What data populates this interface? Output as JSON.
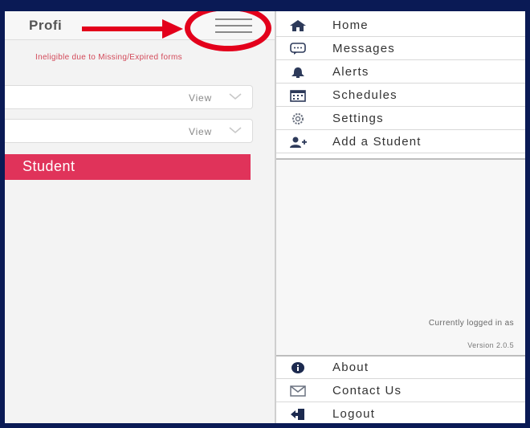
{
  "left_panel": {
    "title": "Profi",
    "notice": "Ineligible due to Missing/Expired forms",
    "rows": [
      {
        "action": "View"
      },
      {
        "action": "View"
      }
    ],
    "add_student_label": "Student"
  },
  "drawer": {
    "menu": [
      {
        "label": "Home",
        "icon": "home-icon"
      },
      {
        "label": "Messages",
        "icon": "message-icon"
      },
      {
        "label": "Alerts",
        "icon": "bell-icon"
      },
      {
        "label": "Schedules",
        "icon": "calendar-icon"
      },
      {
        "label": "Settings",
        "icon": "gear-icon"
      },
      {
        "label": "Add a Student",
        "icon": "add-user-icon"
      }
    ],
    "logged_in_text": "Currently logged in as",
    "version_text": "Version 2.0.5",
    "footer_menu": [
      {
        "label": "About",
        "icon": "info-icon"
      },
      {
        "label": "Contact Us",
        "icon": "envelope-icon"
      },
      {
        "label": "Logout",
        "icon": "logout-icon"
      }
    ]
  },
  "colors": {
    "frame": "#0a1a55",
    "accent_pink": "#e0335a",
    "annotation_red": "#e3001b"
  }
}
